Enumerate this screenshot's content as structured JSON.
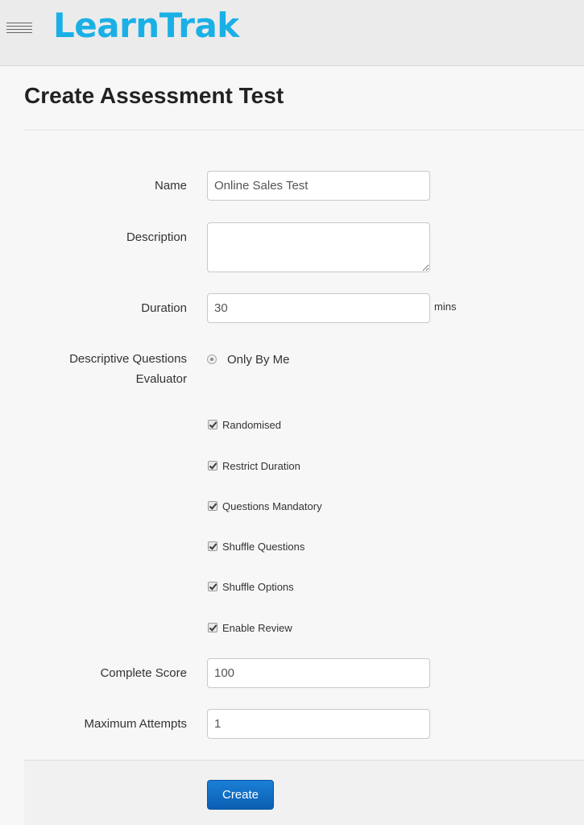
{
  "app": {
    "logo_learn": "Learn",
    "logo_trak": "Trak",
    "brand_color": "#1ab0e6"
  },
  "header": {
    "menu_icon": "hamburger-menu-icon"
  },
  "page": {
    "title": "Create Assessment Test"
  },
  "form": {
    "name": {
      "label": "Name",
      "value": "Online Sales Test"
    },
    "description": {
      "label": "Description",
      "value": ""
    },
    "duration": {
      "label": "Duration",
      "value": "30",
      "unit": "mins"
    },
    "evaluator": {
      "label_line1": "Descriptive Questions",
      "label_line2": "Evaluator",
      "option": "Only By Me",
      "selected": true
    },
    "options": [
      {
        "label": "Randomised",
        "checked": true
      },
      {
        "label": "Restrict Duration",
        "checked": true
      },
      {
        "label": "Questions Mandatory",
        "checked": true
      },
      {
        "label": "Shuffle Questions",
        "checked": true
      },
      {
        "label": "Shuffle Options",
        "checked": true
      },
      {
        "label": "Enable Review",
        "checked": true
      }
    ],
    "complete_score": {
      "label": "Complete Score",
      "value": "100"
    },
    "maximum_attempts": {
      "label": "Maximum Attempts",
      "value": "1"
    }
  },
  "footer": {
    "create_label": "Create",
    "create_color": "#0b6fc8"
  }
}
